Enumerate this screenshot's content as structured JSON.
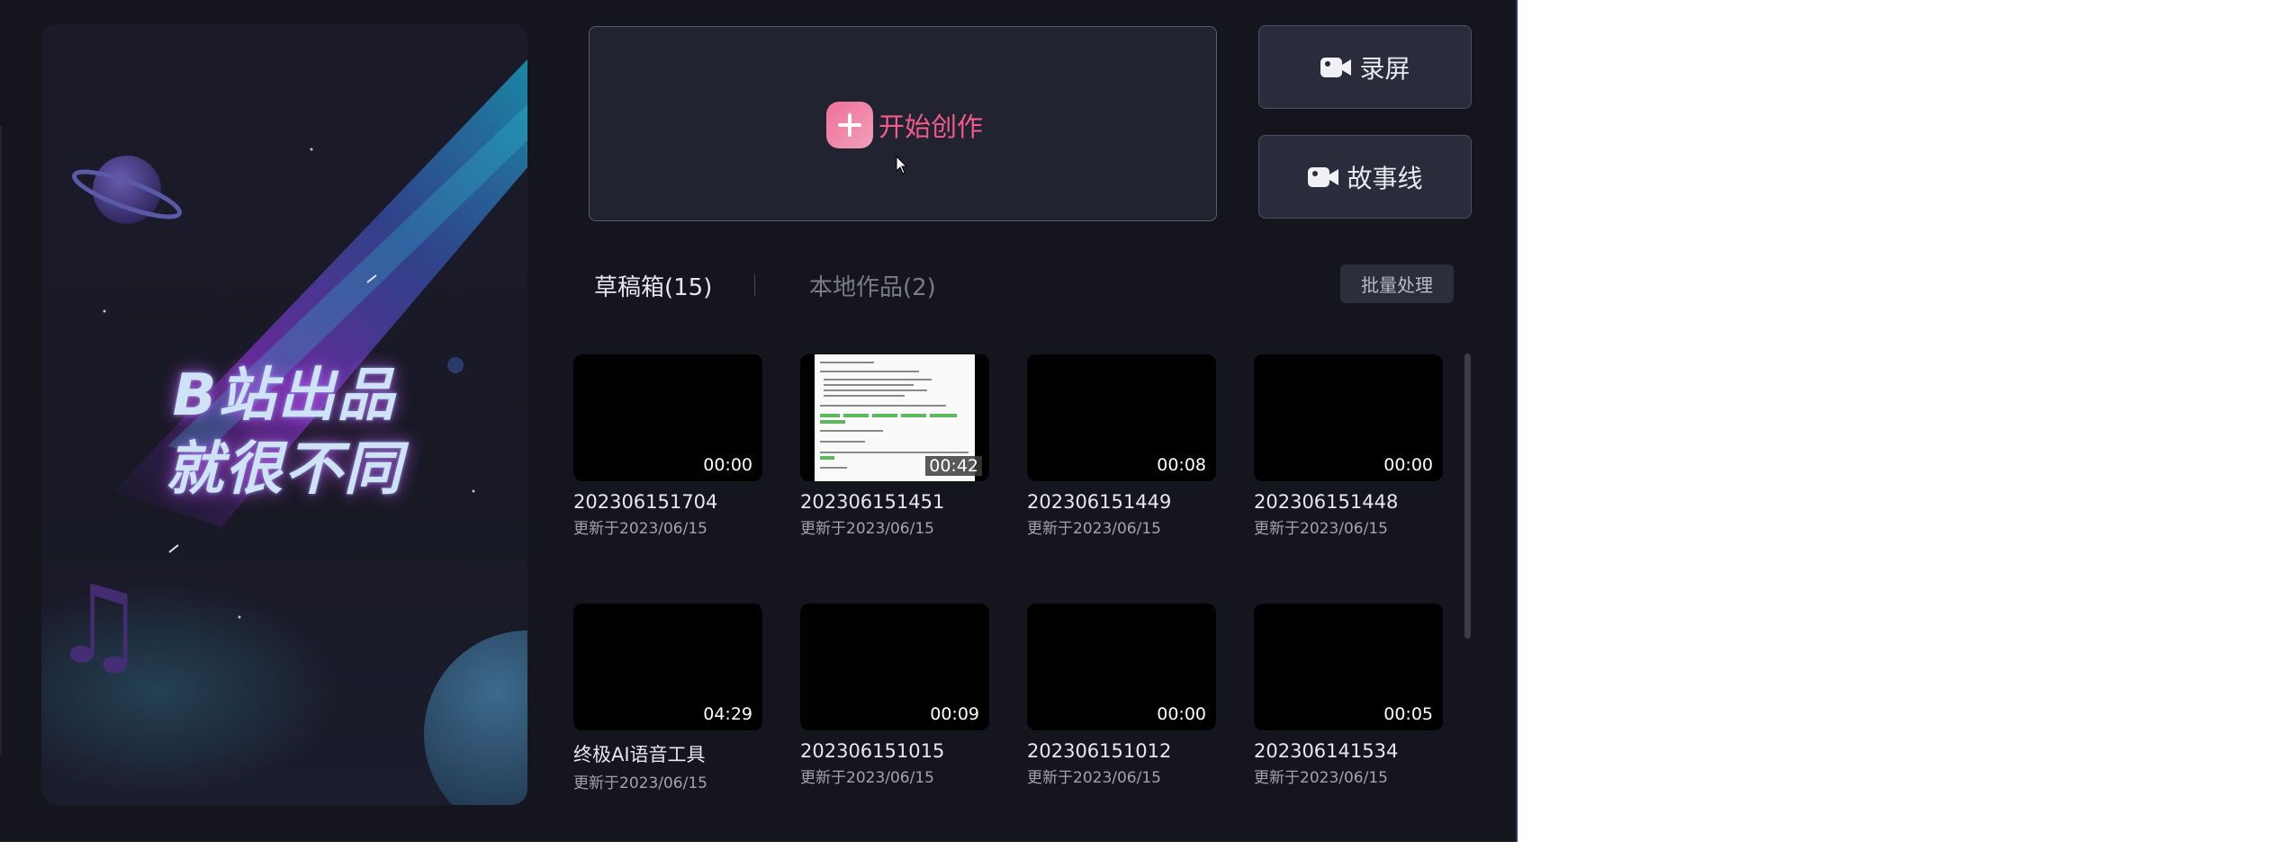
{
  "banner": {
    "line1": "B站出品",
    "line2": "就很不同"
  },
  "create": {
    "label": "开始创作"
  },
  "side_buttons": [
    {
      "label": "录屏",
      "icon": "camera-icon"
    },
    {
      "label": "故事线",
      "icon": "camera-icon"
    }
  ],
  "tabs": {
    "drafts": "草稿箱(15)",
    "local": "本地作品(2)",
    "active": "drafts"
  },
  "batch_label": "批量处理",
  "cards": [
    {
      "title": "202306151704",
      "date": "更新于2023/06/15",
      "duration": "00:00"
    },
    {
      "title": "202306151451",
      "date": "更新于2023/06/15",
      "duration": "00:42"
    },
    {
      "title": "202306151449",
      "date": "更新于2023/06/15",
      "duration": "00:08"
    },
    {
      "title": "202306151448",
      "date": "更新于2023/06/15",
      "duration": "00:00"
    },
    {
      "title": "终极AI语音工具",
      "date": "更新于2023/06/15",
      "duration": "04:29"
    },
    {
      "title": "202306151015",
      "date": "更新于2023/06/15",
      "duration": "00:09"
    },
    {
      "title": "202306151012",
      "date": "更新于2023/06/15",
      "duration": "00:00"
    },
    {
      "title": "202306141534",
      "date": "更新于2023/06/15",
      "duration": "00:05"
    }
  ],
  "colors": {
    "background": "#15151e",
    "accent_pink": "#f25b8a",
    "button_bg": "#2b2c3b"
  }
}
